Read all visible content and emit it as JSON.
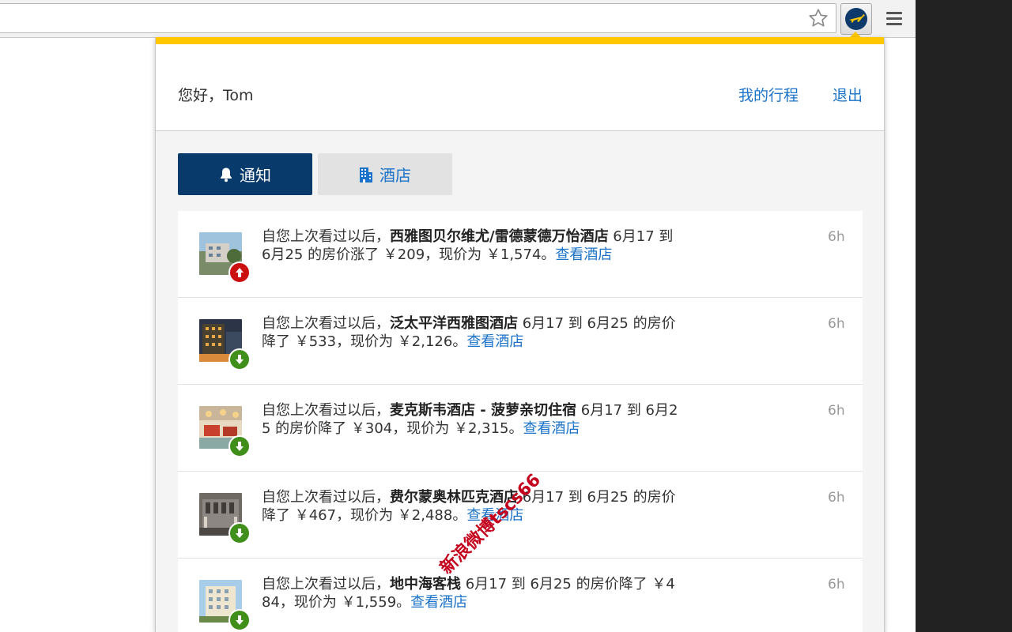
{
  "header": {
    "greeting": "您好，Tom",
    "my_trips": "我的行程",
    "logout": "退出"
  },
  "tabs": [
    {
      "label": "通知",
      "icon": "bell-icon",
      "active": true
    },
    {
      "label": "酒店",
      "icon": "building-icon",
      "active": false
    }
  ],
  "notifications": [
    {
      "prefix": "自您上次看过以后，",
      "hotel": "西雅图贝尔维尤/雷德蒙德万怡酒店",
      "suffix": " 6月17 到 6月25 的房价涨了 ￥209，现价为 ￥1,574。",
      "link": "查看酒店",
      "time": "6h",
      "direction": "up"
    },
    {
      "prefix": "自您上次看过以后，",
      "hotel": "泛太平洋西雅图酒店",
      "suffix": " 6月17 到 6月25 的房价降了 ￥533，现价为 ￥2,126。",
      "link": "查看酒店",
      "time": "6h",
      "direction": "down"
    },
    {
      "prefix": "自您上次看过以后，",
      "hotel": "麦克斯韦酒店 - 菠萝亲切住宿",
      "suffix": " 6月17 到 6月25 的房价降了 ￥304，现价为 ￥2,315。",
      "link": "查看酒店",
      "time": "6h",
      "direction": "down"
    },
    {
      "prefix": "自您上次看过以后，",
      "hotel": "费尔蒙奥林匹克酒店",
      "suffix": " 6月17 到 6月25 的房价降了 ￥467，现价为 ￥2,488。",
      "link": "查看酒店",
      "time": "6h",
      "direction": "down"
    },
    {
      "prefix": "自您上次看过以后，",
      "hotel": "地中海客栈",
      "suffix": " 6月17 到 6月25 的房价降了 ￥484，现价为 ￥1,559。",
      "link": "查看酒店",
      "time": "6h",
      "direction": "down"
    }
  ],
  "watermark": "新浪微博tscs66",
  "colors": {
    "accent_yellow": "#ffc700",
    "active_tab": "#083a6b",
    "link_blue": "#1a73c8",
    "price_up": "#cc1010",
    "price_down": "#3f8f1a"
  }
}
